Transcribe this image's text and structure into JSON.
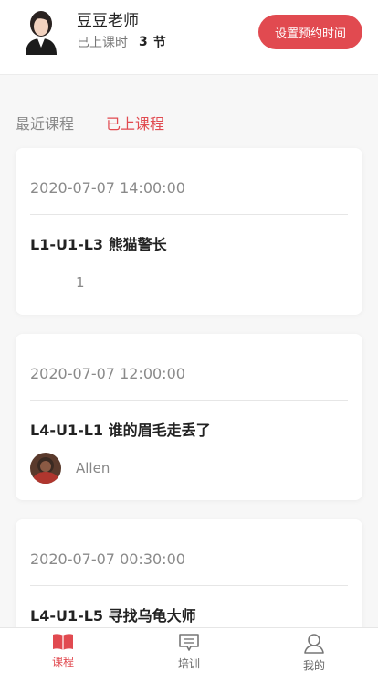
{
  "header": {
    "teacher_name": "豆豆老师",
    "lessons_label": "已上课时",
    "lessons_count": "3",
    "lessons_unit": "节",
    "set_time_button": "设置预约时间"
  },
  "tabs": [
    {
      "label": "最近课程",
      "active": false
    },
    {
      "label": "已上课程",
      "active": true
    }
  ],
  "courses": [
    {
      "time": "2020-07-07 14:00:00",
      "title": "L1-U1-L3 熊猫警长",
      "student": "1"
    },
    {
      "time": "2020-07-07 12:00:00",
      "title": "L4-U1-L1 谁的眉毛走丢了",
      "student": "Allen"
    },
    {
      "time": "2020-07-07 00:30:00",
      "title": "L4-U1-L5 寻找乌龟大师",
      "student": ""
    }
  ],
  "tabbar": [
    {
      "label": "课程",
      "icon": "book-icon",
      "active": true
    },
    {
      "label": "培训",
      "icon": "chat-icon",
      "active": false
    },
    {
      "label": "我的",
      "icon": "user-icon",
      "active": false
    }
  ],
  "colors": {
    "accent": "#e14a50",
    "background": "#f7f7f7"
  }
}
